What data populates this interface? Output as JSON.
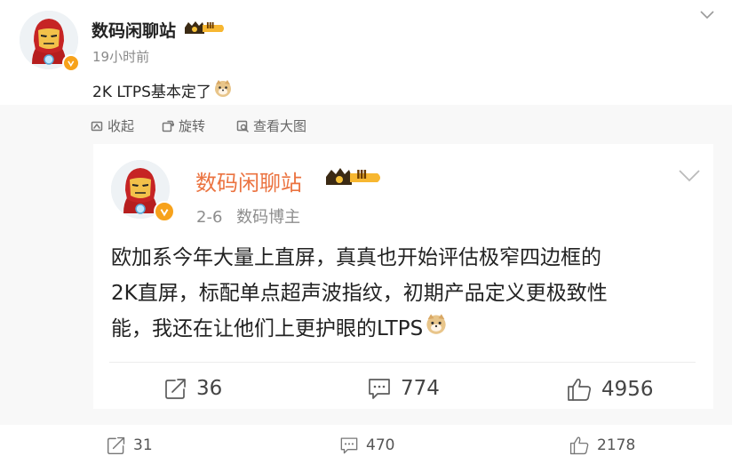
{
  "post": {
    "author": "数码闲聊站",
    "rank_badge": "Ⅲ",
    "time": "19小时前",
    "text": "2K LTPS基本定了",
    "actions": {
      "collapse_label": "收起",
      "rotate_label": "旋转",
      "view_image_label": "查看大图"
    }
  },
  "repost": {
    "author": "数码闲聊站",
    "rank_badge": "Ⅲ",
    "date": "2-6",
    "role": "数码博主",
    "text_lines": [
      "欧加系今年大量上直屏，真真也开始评估极窄四边框的",
      "2K直屏，标配单点超声波指纹，初期产品定义更极致性",
      "能，我还在让他们上更护眼的LTPS"
    ],
    "stats": {
      "forwards": "36",
      "comments": "774",
      "likes": "4956"
    }
  },
  "footer": {
    "forwards": "31",
    "comments": "470",
    "likes": "2178"
  },
  "colors": {
    "repost_name": "#eb7340",
    "badge_gold": "#f7a21b",
    "panel_bg": "#f8f8f8"
  }
}
